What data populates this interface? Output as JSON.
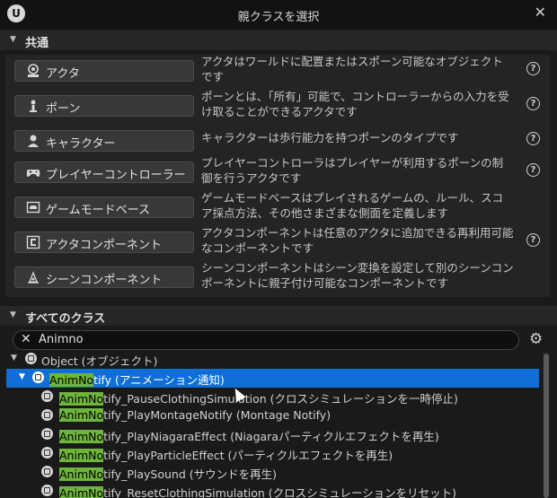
{
  "window": {
    "title": "親クラスを選択",
    "close_glyph": "✕",
    "logo_glyph": "U"
  },
  "common": {
    "header": "共通",
    "items": [
      {
        "label": "アクタ",
        "icon": "actor-icon",
        "desc": "アクタはワールドに配置またはスポーン可能なオブジェクトです"
      },
      {
        "label": "ポーン",
        "icon": "pawn-icon",
        "desc": "ポーンとは、「所有」可能で、コントローラーからの入力を受け取ることができるアクタです"
      },
      {
        "label": "キャラクター",
        "icon": "character-icon",
        "desc": "キャラクターは歩行能力を持つポーンのタイプです"
      },
      {
        "label": "プレイヤーコントローラー",
        "icon": "gamepad-icon",
        "desc": "プレイヤーコントローラはプレイヤーが利用するポーンの制御を行うアクタです"
      },
      {
        "label": "ゲームモードベース",
        "icon": "game-mode-icon",
        "desc": "ゲームモードベースはプレイされるゲームの、ルール、スコア採点方法、その他さまざまな側面を定義します"
      },
      {
        "label": "アクタコンポーネント",
        "icon": "actor-component-icon",
        "desc": "アクタコンポーネントは任意のアクタに追加できる再利用可能なコンポーネントです"
      },
      {
        "label": "シーンコンポーネント",
        "icon": "scene-component-icon",
        "desc": "シーンコンポーネントはシーン変換を設定して別のシーンコンポーネントに親子付け可能なコンポーネントです"
      }
    ]
  },
  "all_classes": {
    "header": "すべてのクラス",
    "search": {
      "value": "Animno",
      "placeholder": ""
    },
    "tree": {
      "root": "Object (オブジェクト)",
      "selected": {
        "match": "AnimNo",
        "rest": "tify (アニメーション通知)"
      },
      "children": [
        {
          "match": "AnimNo",
          "rest": "tify_PauseClothingSimulation (クロスシミュレーションを一時停止)"
        },
        {
          "match": "AnimNo",
          "rest": "tify_PlayMontageNotify (Montage Notify)"
        },
        {
          "match": "AnimNo",
          "rest": "tify_PlayNiagaraEffect (Niagaraパーティクルエフェクトを再生)"
        },
        {
          "match": "AnimNo",
          "rest": "tify_PlayParticleEffect (パーティクルエフェクトを再生)"
        },
        {
          "match": "AnimNo",
          "rest": "tify_PlaySound (サウンドを再生)"
        },
        {
          "match": "AnimNo",
          "rest": "tify_ResetClothingSimulation (クロスシミュレーションをリセット)"
        }
      ]
    }
  },
  "glyphs": {
    "expand": "▼",
    "help": "?",
    "clear": "✕",
    "gear": "⚙"
  }
}
